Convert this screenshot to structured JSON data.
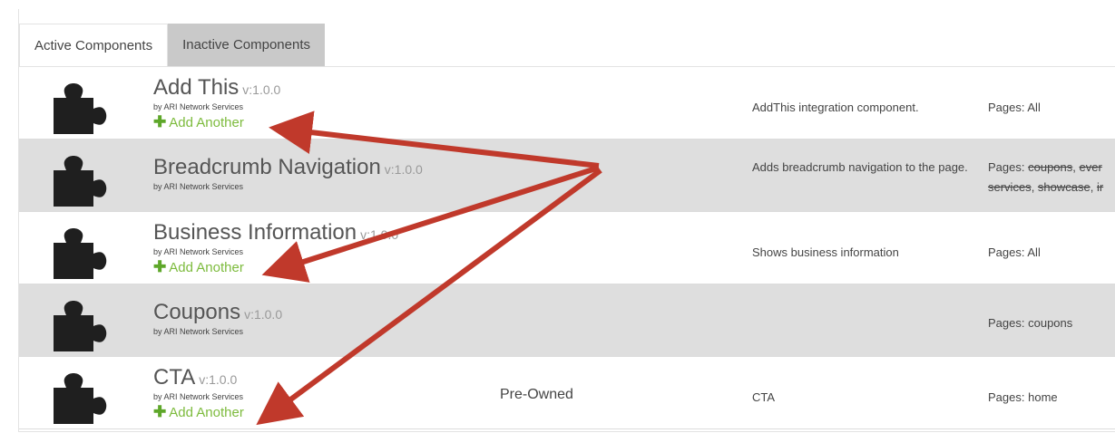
{
  "tabs": [
    {
      "label": "Active Components",
      "active": true
    },
    {
      "label": "Inactive Components",
      "active": false
    }
  ],
  "components": [
    {
      "name": "Add This",
      "version": "v:1.0.0",
      "author": "by ARI Network Services",
      "add_another": "Add Another",
      "category": "",
      "description": "AddThis integration component.",
      "pages_label": "Pages:",
      "pages_value": "All"
    },
    {
      "name": "Breadcrumb Navigation",
      "version": "v:1.0.0",
      "author": "by ARI Network Services",
      "add_another": "",
      "category": "",
      "description": "Adds breadcrumb navigation to the page.",
      "pages_label": "Pages:",
      "pages_struck_1": "coupons",
      "pages_struck_2": "ever",
      "pages_struck_3": "services",
      "pages_struck_4": "showcase",
      "pages_struck_5": "ir"
    },
    {
      "name": "Business Information",
      "version": "v:1.0.0",
      "author": "by ARI Network Services",
      "add_another": "Add Another",
      "category": "",
      "description": "Shows business information",
      "pages_label": "Pages:",
      "pages_value": "All"
    },
    {
      "name": "Coupons",
      "version": "v:1.0.0",
      "author": "by ARI Network Services",
      "add_another": "",
      "category": "",
      "description": "",
      "pages_label": "Pages:",
      "pages_value": "coupons"
    },
    {
      "name": "CTA",
      "version": "v:1.0.0",
      "author": "by ARI Network Services",
      "add_another": "Add Another",
      "category": "Pre-Owned",
      "description": "CTA",
      "pages_label": "Pages:",
      "pages_value": "home"
    }
  ],
  "colors": {
    "accent_green": "#7dbb3d",
    "alt_row": "#dedede",
    "arrow": "#c0392b"
  }
}
